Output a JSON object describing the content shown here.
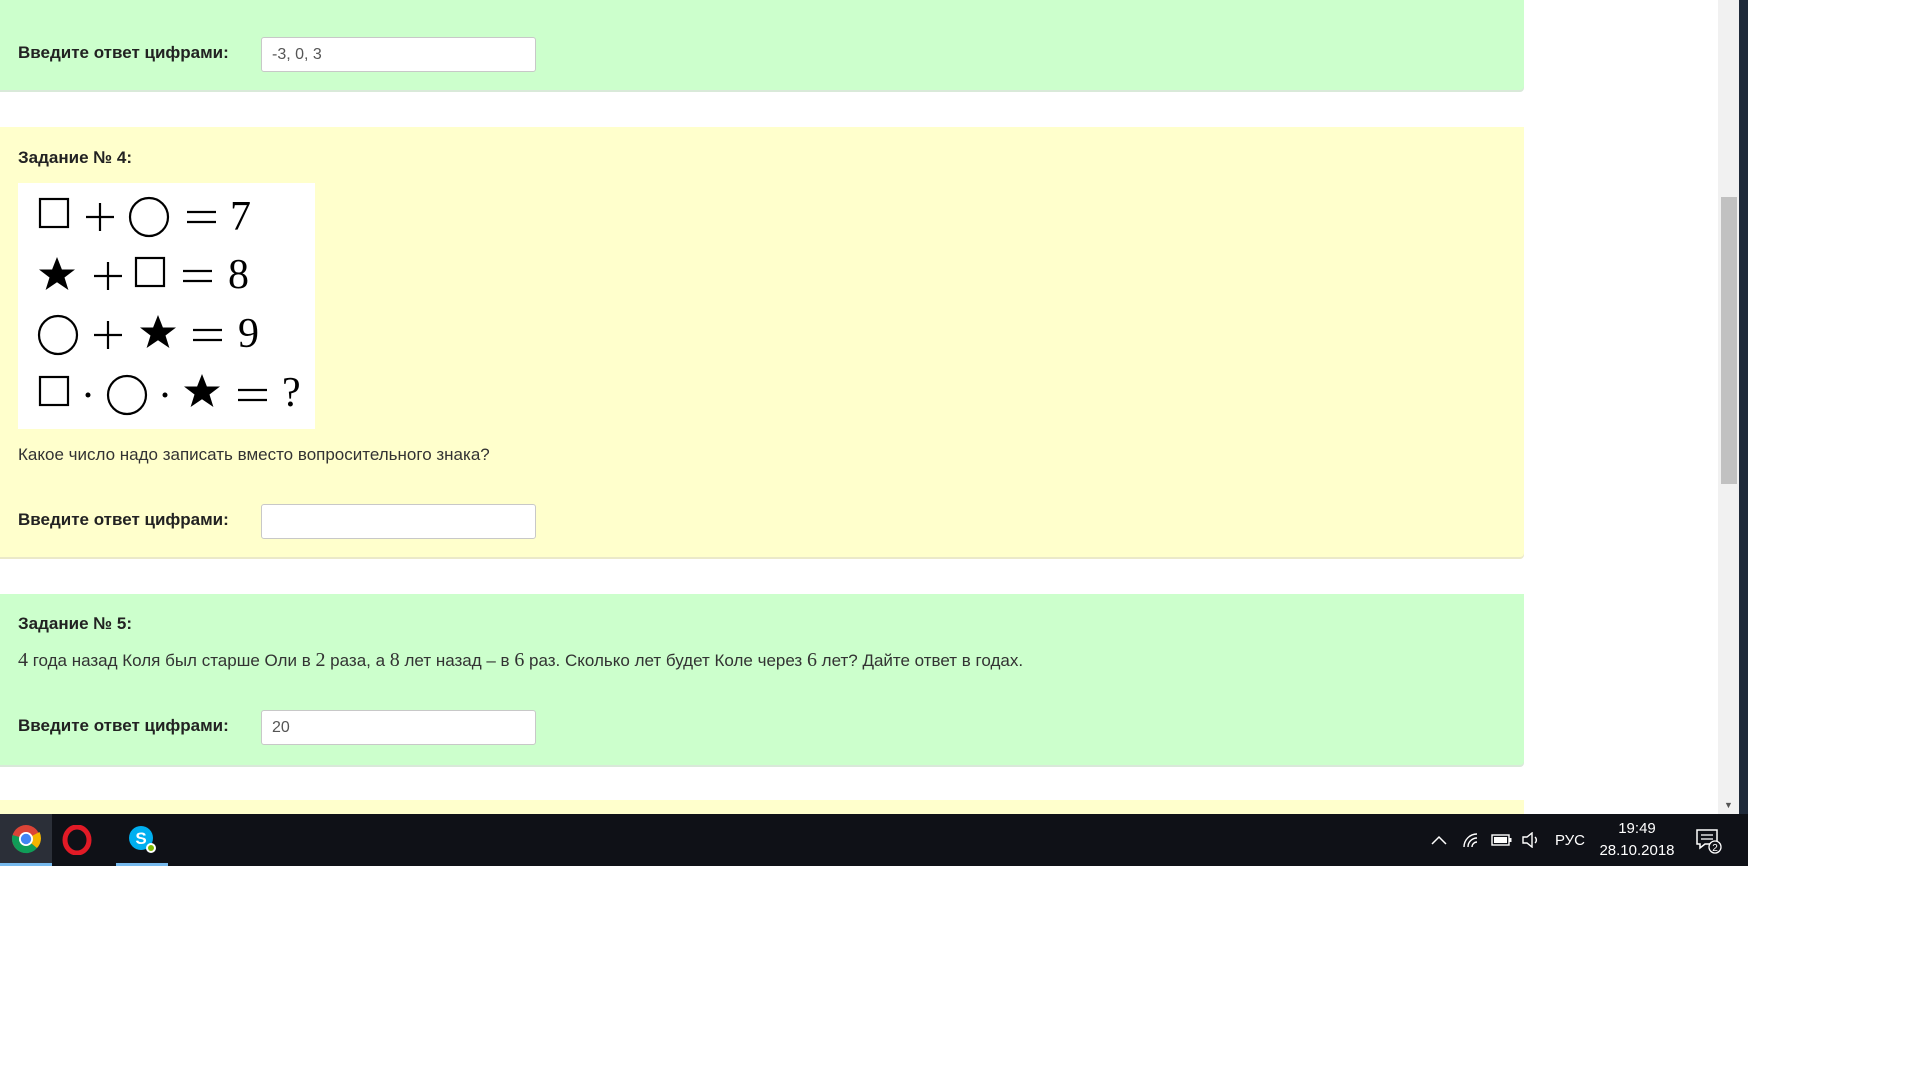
{
  "tasks": {
    "task3": {
      "answer_label": "Введите ответ цифрами:",
      "answer_value": "-3, 0, 3"
    },
    "task4": {
      "title": "Задание № 4:",
      "puzzle": {
        "rows": [
          [
            "square",
            "+",
            "circle",
            "=",
            "7"
          ],
          [
            "star",
            "+",
            "square",
            "=",
            "8"
          ],
          [
            "circle",
            "+",
            "star",
            "=",
            "9"
          ],
          [
            "square",
            "·",
            "circle",
            "·",
            "star",
            "=",
            "?"
          ]
        ]
      },
      "question": "Какое число надо записать вместо вопросительного знака?",
      "answer_label": "Введите ответ цифрами:",
      "answer_value": ""
    },
    "task5": {
      "title": "Задание № 5:",
      "text_parts": [
        "4",
        " года назад Коля был старше Оли в ",
        "2",
        " раза, а ",
        "8",
        " лет назад – в ",
        "6",
        " раз. Сколько лет будет Коле через ",
        "6",
        " лет? Дайте ответ в годах."
      ],
      "answer_label": "Введите ответ цифрами:",
      "answer_value": "20"
    }
  },
  "colors": {
    "green_card": "#ccffcc",
    "yellow_card": "#ffffcc",
    "taskbar": "#0f1117",
    "taskbar_accent": "#76b9ed"
  },
  "taskbar": {
    "apps": [
      {
        "name": "Google Chrome",
        "icon": "chrome-icon"
      },
      {
        "name": "Opera",
        "icon": "opera-icon"
      },
      {
        "name": "Skype",
        "icon": "skype-icon"
      }
    ],
    "tray": {
      "language": "РУС",
      "time": "19:49",
      "date": "28.10.2018",
      "notifications_count": "2"
    }
  }
}
